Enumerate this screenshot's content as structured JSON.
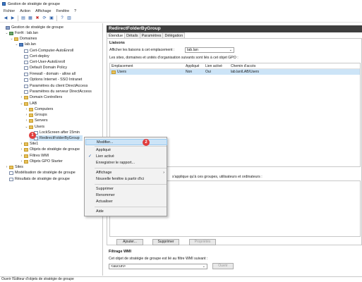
{
  "window": {
    "title": "Gestion de stratégie de groupe"
  },
  "menu": [
    "Fichier",
    "Action",
    "Affichage",
    "Fenêtre",
    "?"
  ],
  "tree": {
    "items": [
      {
        "label": "Gestion de stratégie de groupe",
        "icon": "gpm-root-icon"
      },
      {
        "label": "Forêt : lab.lan",
        "icon": "forest-icon"
      },
      {
        "label": "Domaines",
        "icon": "folder-icon"
      },
      {
        "label": "lab.lan",
        "icon": "domain-icon"
      },
      {
        "label": "Cert-Computer-AutoEnroll",
        "icon": "gpo-link-icon"
      },
      {
        "label": "Cert-deploy",
        "icon": "gpo-link-icon"
      },
      {
        "label": "Cert-User-AutoEnroll",
        "icon": "gpo-link-icon"
      },
      {
        "label": "Default Domain Policy",
        "icon": "gpo-link-icon"
      },
      {
        "label": "Firewall - domain - allow all",
        "icon": "gpo-link-icon"
      },
      {
        "label": "Options Internet - SSO Intranet",
        "icon": "gpo-link-icon"
      },
      {
        "label": "Paramètres du client DirectAccess",
        "icon": "gpo-link-icon"
      },
      {
        "label": "Paramètres du serveur DirectAccess",
        "icon": "gpo-link-icon"
      },
      {
        "label": "Domain Controllers",
        "icon": "ou-icon"
      },
      {
        "label": "LAB",
        "icon": "ou-icon"
      },
      {
        "label": "Computers",
        "icon": "ou-icon"
      },
      {
        "label": "Groups",
        "icon": "ou-icon"
      },
      {
        "label": "Servers",
        "icon": "ou-icon"
      },
      {
        "label": "Users",
        "icon": "ou-icon"
      },
      {
        "label": "LockScreen after 15min",
        "icon": "gpo-link-icon"
      },
      {
        "label": "RedirectFolderByGroup",
        "icon": "gpo-link-icon"
      },
      {
        "label": "Site1",
        "icon": "ou-icon"
      },
      {
        "label": "Objets de stratégie de groupe",
        "icon": "folder-icon"
      },
      {
        "label": "Filtres WMI",
        "icon": "folder-icon"
      },
      {
        "label": "Objets GPO Starter",
        "icon": "folder-icon"
      },
      {
        "label": "Sites",
        "icon": "folder-icon"
      },
      {
        "label": "Modélisation de stratégie de groupe",
        "icon": "modeling-icon"
      },
      {
        "label": "Résultats de stratégie de groupe",
        "icon": "results-icon"
      }
    ]
  },
  "badges": {
    "one": "1",
    "two": "2"
  },
  "gpo": {
    "title": "RedirectFolderByGroup",
    "tabs": [
      "Étendue",
      "Détails",
      "Paramètres",
      "Délégation"
    ],
    "links_heading": "Liaisons",
    "links_location_label": "Afficher les liaisons à cet emplacement :",
    "links_location_value": "lab.lan",
    "links_desc": "Les sites, domaines et unités d'organisation suivants sont liés à cet objet GPO :",
    "columns": [
      "Emplacement",
      "Appliqué",
      "Lien activé",
      "Chemin d'accès"
    ],
    "rows": [
      {
        "location": "Users",
        "enforced": "Non",
        "enabled": "Oui",
        "path": "lab.lan/LAB/Users"
      }
    ],
    "filter_desc": "s'applique qu'à ces groupes, utilisateurs et ordinateurs :",
    "buttons": {
      "add": "Ajouter...",
      "remove": "Supprimer",
      "properties": "Propriétés"
    },
    "wmi_heading": "Filtrage WMI",
    "wmi_desc": "Cet objet de stratégie de groupe est lié au filtre WMI suivant :",
    "wmi_value": "<aucun>",
    "wmi_open": "Ouvrir"
  },
  "context_menu": {
    "edit": "Modifier...",
    "enforced": "Appliqué",
    "link_enabled": "Lien activé",
    "save_report": "Enregistrer le rapport...",
    "view": "Affichage",
    "new_window": "Nouvelle fenêtre à partir d'ici",
    "delete": "Supprimer",
    "rename": "Renommer",
    "refresh": "Actualiser",
    "help": "Aide"
  },
  "status": {
    "text": "Ouvrir l'Éditeur d'objets de stratégie de groupe"
  },
  "colors": {
    "accent": "#3c78c8",
    "badge": "#e03c3c",
    "highlight": "#cce4f7"
  }
}
